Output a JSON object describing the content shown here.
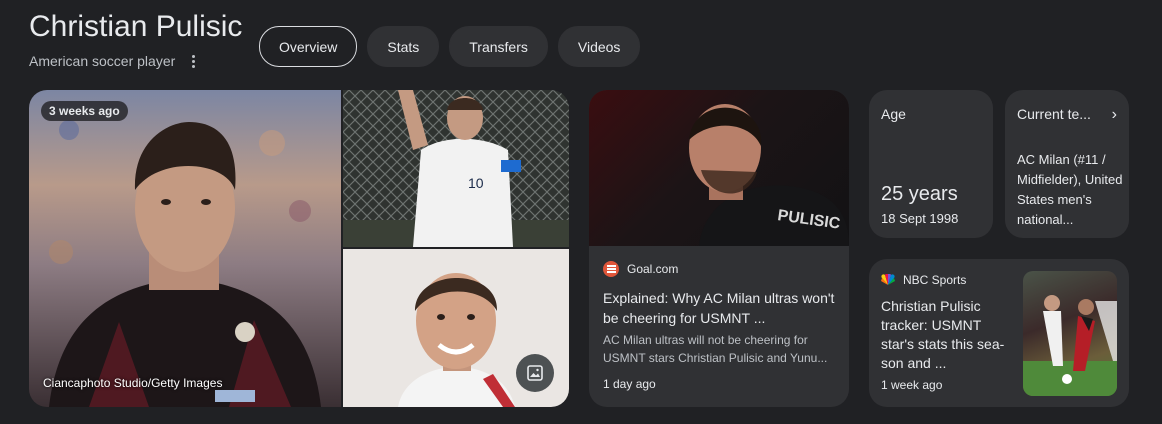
{
  "header": {
    "title": "Christian Pulisic",
    "subtitle": "American soccer player"
  },
  "tabs": [
    {
      "label": "Overview",
      "active": true
    },
    {
      "label": "Stats",
      "active": false
    },
    {
      "label": "Transfers",
      "active": false
    },
    {
      "label": "Videos",
      "active": false
    }
  ],
  "photos": {
    "badge": "3 weeks ago",
    "credit": "Ciancaphoto Studio/Getty Images",
    "jersey_number": "10",
    "shirt_name": "PULISIC",
    "images_icon": "image-icon"
  },
  "news": {
    "source": "Goal.com",
    "title": "Explained: Why AC Milan ultras won't be cheering for USMNT ...",
    "snippet": "AC Milan ultras will not be cheering for USMNT stars Christian Pulisic and Yunu...",
    "time": "1 day ago"
  },
  "age": {
    "label": "Age",
    "value": "25 years",
    "date": "18 Sept 1998"
  },
  "team": {
    "label": "Current te...",
    "value": "AC Milan (#11 / Midfielder), United States men's national..."
  },
  "nbc": {
    "source": "NBC Sports",
    "title": "Christian Pulisic tracker: USMNT star's stats this sea-son and ...",
    "time": "1 week ago"
  },
  "colors": {
    "background": "#202124",
    "card": "#303134",
    "text": "#e8eaed",
    "muted": "#bdc1c6",
    "goal_brand": "#e0563a"
  }
}
